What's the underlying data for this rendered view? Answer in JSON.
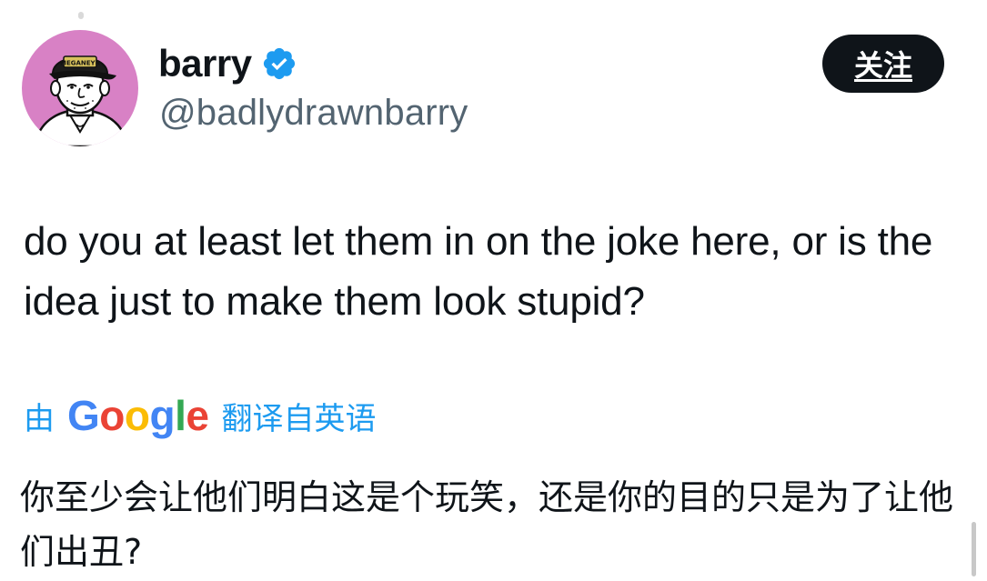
{
  "author": {
    "display_name": "barry",
    "handle": "@badlydrawnbarry",
    "verified": true,
    "avatar_hat_text": "MEGANEYR"
  },
  "follow_button": {
    "label": "关注"
  },
  "tweet": {
    "text": "do you at least let them in on the joke here, or is the idea just to make them look stupid?"
  },
  "translation": {
    "prefix": "由",
    "provider": "Google",
    "suffix": "翻译自英语",
    "text": "你至少会让他们明白这是个玩笑，还是你的目的只是为了让他们出丑?"
  },
  "colors": {
    "text_primary": "#0f1419",
    "text_secondary": "#536471",
    "accent_blue": "#1d9bf0",
    "avatar_bg": "#d881c5",
    "google_blue": "#4285F4",
    "google_red": "#EA4335",
    "google_yellow": "#FBBC05",
    "google_green": "#34A853"
  },
  "icons": {
    "verified": "verified-badge-icon",
    "avatar": "cartoon-portrait"
  }
}
